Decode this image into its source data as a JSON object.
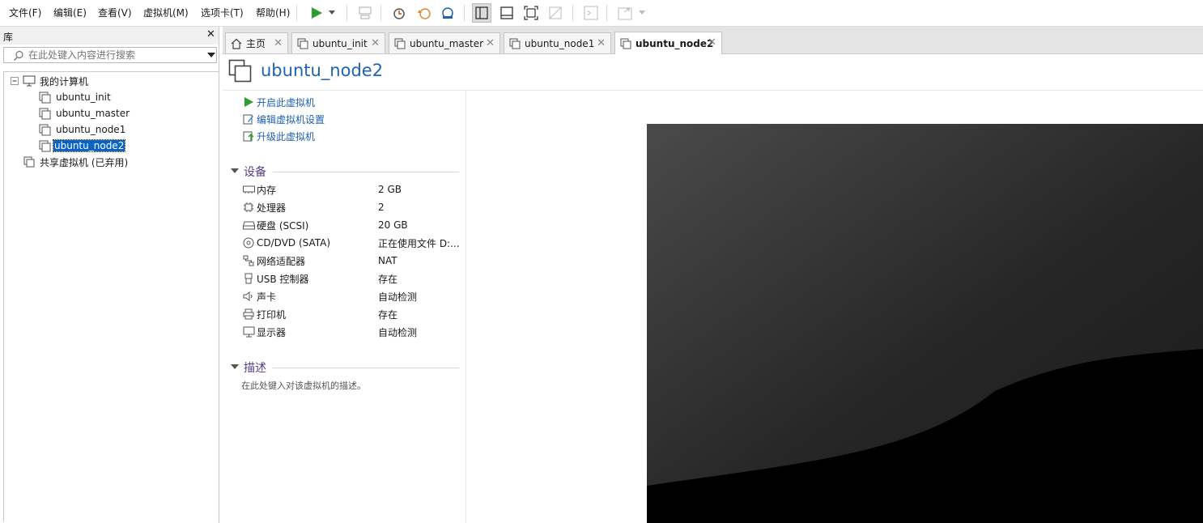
{
  "menu": {
    "items": [
      "文件(F)",
      "编辑(E)",
      "查看(V)",
      "虚拟机(M)",
      "选项卡(T)",
      "帮助(H)"
    ]
  },
  "colors": {
    "accent": "#1e63b4",
    "play": "#2e9e2e",
    "selection": "#0a64c8",
    "section": "#553c8c"
  },
  "library": {
    "title": "库",
    "close": "✕",
    "search_placeholder": "在此处键入内容进行搜索",
    "tree": {
      "root": "我的计算机",
      "vms": [
        "ubuntu_init",
        "ubuntu_master",
        "ubuntu_node1",
        "ubuntu_node2"
      ],
      "selected": "ubuntu_node2",
      "shared": "共享虚拟机 (已弃用)"
    }
  },
  "tabs": [
    {
      "label": "主页",
      "icon": "home-icon"
    },
    {
      "label": "ubuntu_init",
      "icon": "vm-icon"
    },
    {
      "label": "ubuntu_master",
      "icon": "vm-icon"
    },
    {
      "label": "ubuntu_node1",
      "icon": "vm-icon"
    },
    {
      "label": "ubuntu_node2",
      "icon": "vm-icon",
      "active": true
    }
  ],
  "vm": {
    "title": "ubuntu_node2",
    "actions": [
      "开启此虚拟机",
      "编辑虚拟机设置",
      "升级此虚拟机"
    ],
    "devices_heading": "设备",
    "devices": [
      {
        "name": "内存",
        "value": "2 GB",
        "icon": "memory-icon"
      },
      {
        "name": "处理器",
        "value": "2",
        "icon": "cpu-icon"
      },
      {
        "name": "硬盘 (SCSI)",
        "value": "20 GB",
        "icon": "disk-icon"
      },
      {
        "name": "CD/DVD (SATA)",
        "value": "正在使用文件 D:...",
        "icon": "cd-icon"
      },
      {
        "name": "网络适配器",
        "value": "NAT",
        "icon": "network-icon"
      },
      {
        "name": "USB 控制器",
        "value": "存在",
        "icon": "usb-icon"
      },
      {
        "name": "声卡",
        "value": "自动检测",
        "icon": "sound-icon"
      },
      {
        "name": "打印机",
        "value": "存在",
        "icon": "printer-icon"
      },
      {
        "name": "显示器",
        "value": "自动检测",
        "icon": "monitor-icon"
      }
    ],
    "description_heading": "描述",
    "description_placeholder": "在此处键入对该虚拟机的描述。"
  }
}
